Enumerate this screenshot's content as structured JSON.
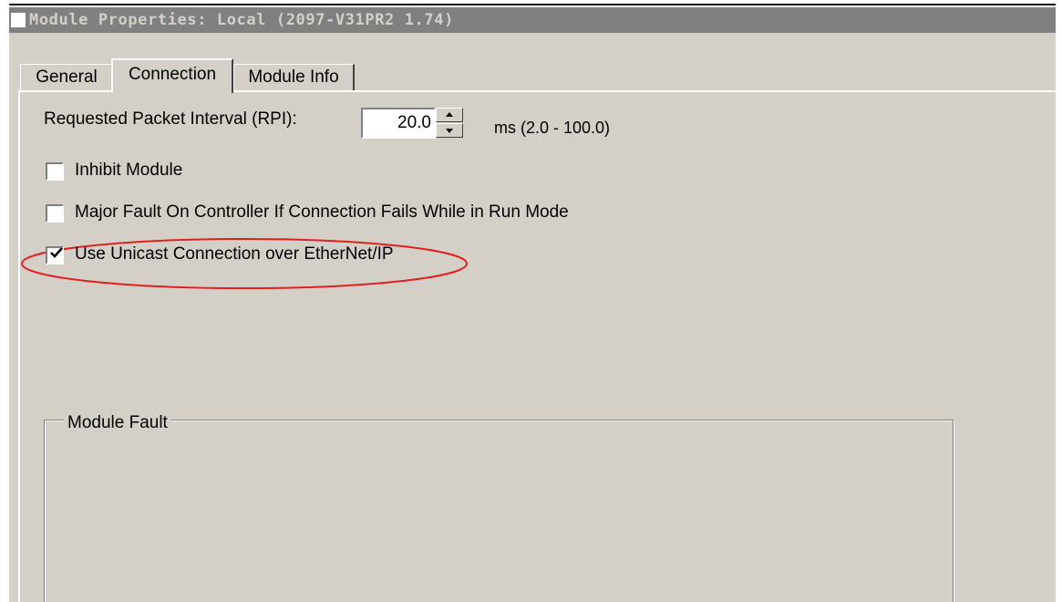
{
  "window": {
    "title": "Module Properties: Local (2097-V31PR2 1.74)"
  },
  "tabs": [
    {
      "label": "General",
      "selected": false
    },
    {
      "label": "Connection",
      "selected": true
    },
    {
      "label": "Module Info",
      "selected": false
    }
  ],
  "connection": {
    "rpi_label": "Requested Packet Interval (RPI):",
    "rpi_value": "20.0",
    "rpi_range": "ms (2.0 - 100.0)",
    "options": [
      {
        "label": "Inhibit Module",
        "checked": false
      },
      {
        "label": "Major Fault On Controller If Connection Fails While in Run Mode",
        "checked": false
      },
      {
        "label": "Use Unicast Connection over EtherNet/IP",
        "checked": true
      }
    ],
    "highlight_color": "#e02020"
  },
  "module_fault": {
    "label": "Module Fault"
  }
}
